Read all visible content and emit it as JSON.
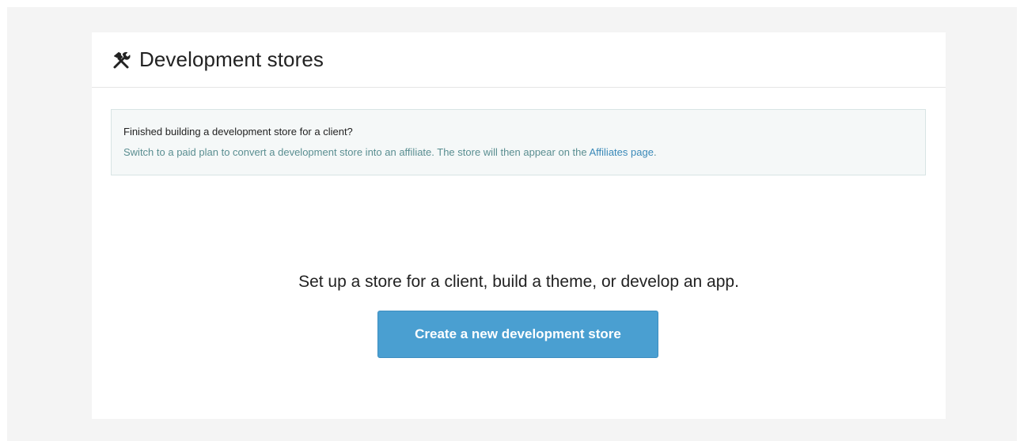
{
  "header": {
    "icon": "hammer-wrench-icon",
    "title": "Development stores"
  },
  "banner": {
    "heading": "Finished building a development store for a client?",
    "text_before_link": "Switch to a paid plan to convert a development store into an affiliate. The store will then appear on the ",
    "link_label": "Affiliates page",
    "text_after_link": "."
  },
  "empty_state": {
    "message": "Set up a store for a client, build a theme, or develop an app.",
    "button_label": "Create a new development store"
  },
  "colors": {
    "accent": "#4a9fd1",
    "link": "#3a89b8",
    "banner_text": "#5a8e91"
  }
}
